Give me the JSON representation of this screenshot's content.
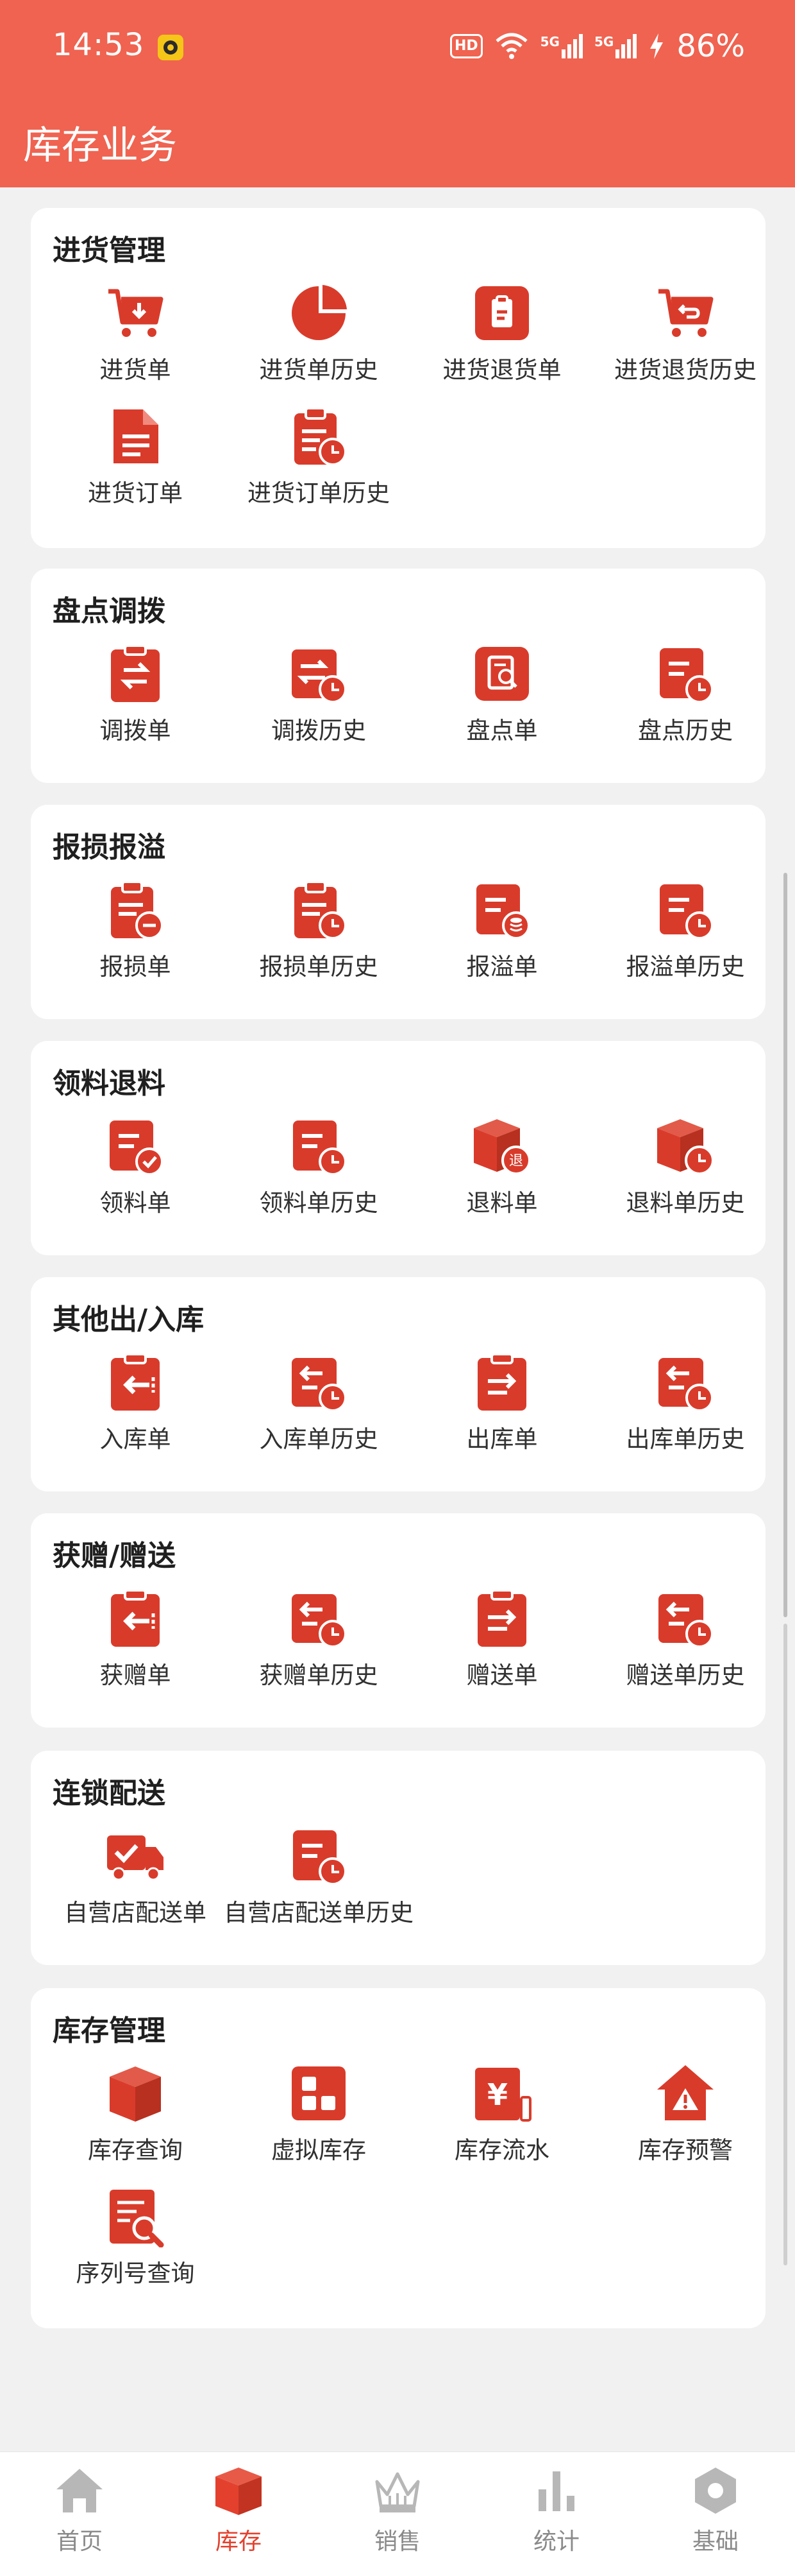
{
  "status_bar": {
    "time": "14:53",
    "battery": "86%",
    "hd_label": "HD",
    "signal1_label": "5G",
    "signal2_label": "5G"
  },
  "page_title": "库存业务",
  "colors": {
    "header": "#ef6350",
    "accent": "#e4402e",
    "icon": "#d93b2b"
  },
  "sections": [
    {
      "title": "进货管理",
      "items": [
        {
          "label": "进货单",
          "icon": "cart-in-icon"
        },
        {
          "label": "进货单历史",
          "icon": "pie-chart-icon"
        },
        {
          "label": "进货退货单",
          "icon": "return-box-icon"
        },
        {
          "label": "进货退货历史",
          "icon": "cart-return-icon"
        },
        {
          "label": "进货订单",
          "icon": "document-icon"
        },
        {
          "label": "进货订单历史",
          "icon": "clipboard-clock-icon"
        }
      ]
    },
    {
      "title": "盘点调拨",
      "items": [
        {
          "label": "调拨单",
          "icon": "transfer-clipboard-icon"
        },
        {
          "label": "调拨历史",
          "icon": "transfer-history-icon"
        },
        {
          "label": "盘点单",
          "icon": "inventory-check-icon"
        },
        {
          "label": "盘点历史",
          "icon": "doc-clock-icon"
        }
      ]
    },
    {
      "title": "报损报溢",
      "items": [
        {
          "label": "报损单",
          "icon": "clipboard-minus-icon"
        },
        {
          "label": "报损单历史",
          "icon": "clipboard-clock-icon"
        },
        {
          "label": "报溢单",
          "icon": "doc-coins-icon"
        },
        {
          "label": "报溢单历史",
          "icon": "doc-clock-icon"
        }
      ]
    },
    {
      "title": "领料退料",
      "items": [
        {
          "label": "领料单",
          "icon": "doc-check-icon"
        },
        {
          "label": "领料单历史",
          "icon": "doc-clock-icon"
        },
        {
          "label": "退料单",
          "icon": "box-return-icon"
        },
        {
          "label": "退料单历史",
          "icon": "box-clock-icon"
        }
      ]
    },
    {
      "title": "其他出/入库",
      "items": [
        {
          "label": "入库单",
          "icon": "clipboard-in-icon"
        },
        {
          "label": "入库单历史",
          "icon": "in-history-icon"
        },
        {
          "label": "出库单",
          "icon": "clipboard-out-icon"
        },
        {
          "label": "出库单历史",
          "icon": "in-history-icon"
        }
      ]
    },
    {
      "title": "获赠/赠送",
      "items": [
        {
          "label": "获赠单",
          "icon": "clipboard-in-icon"
        },
        {
          "label": "获赠单历史",
          "icon": "in-history-icon"
        },
        {
          "label": "赠送单",
          "icon": "clipboard-out-icon"
        },
        {
          "label": "赠送单历史",
          "icon": "in-history-icon"
        }
      ]
    },
    {
      "title": "连锁配送",
      "items": [
        {
          "label": "自营店配送单",
          "icon": "delivery-truck-icon"
        },
        {
          "label": "自营店配送单历史",
          "icon": "doc-clock-icon"
        }
      ]
    },
    {
      "title": "库存管理",
      "items": [
        {
          "label": "库存查询",
          "icon": "cube-icon"
        },
        {
          "label": "虚拟库存",
          "icon": "grid-icon"
        },
        {
          "label": "库存流水",
          "icon": "yen-doc-icon"
        },
        {
          "label": "库存预警",
          "icon": "warning-house-icon"
        },
        {
          "label": "序列号查询",
          "icon": "doc-search-icon"
        }
      ]
    }
  ],
  "bottom_nav": [
    {
      "label": "首页",
      "icon": "home-icon",
      "active": false
    },
    {
      "label": "库存",
      "icon": "box-icon",
      "active": true
    },
    {
      "label": "销售",
      "icon": "crown-icon",
      "active": false
    },
    {
      "label": "统计",
      "icon": "bar-chart-icon",
      "active": false
    },
    {
      "label": "基础",
      "icon": "hexagon-icon",
      "active": false
    }
  ]
}
